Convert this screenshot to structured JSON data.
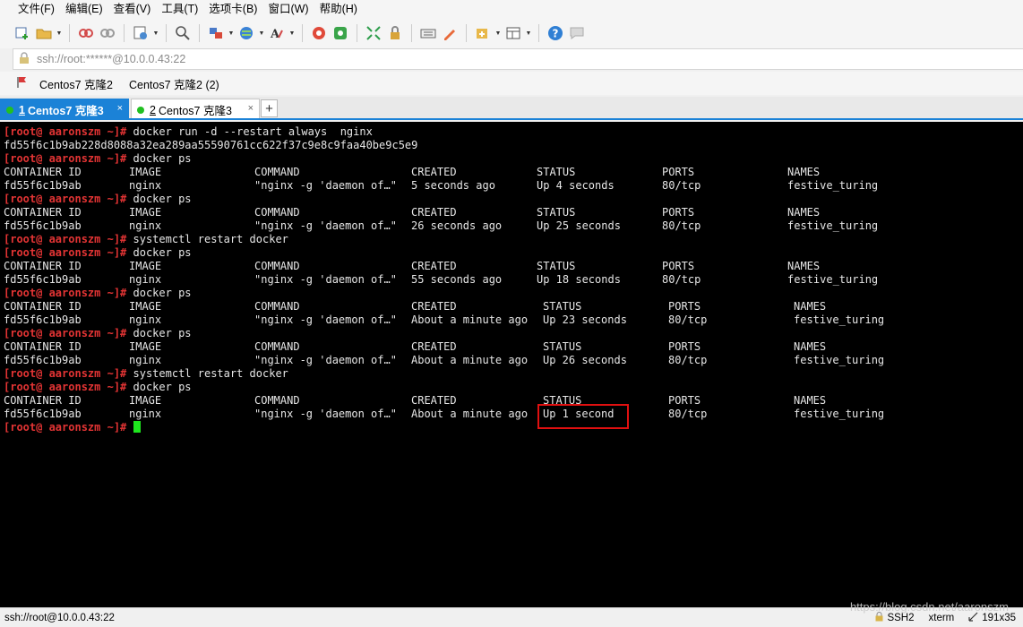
{
  "menu": [
    "文件(F)",
    "编辑(E)",
    "查看(V)",
    "工具(T)",
    "选项卡(B)",
    "窗口(W)",
    "帮助(H)"
  ],
  "address": {
    "text": "ssh://root:******@10.0.0.43:22"
  },
  "bookmarks": [
    "Centos7 克隆2",
    "Centos7 克隆2 (2)"
  ],
  "tabs": [
    {
      "num": "1",
      "label": "Centos7 克隆3",
      "close": "×",
      "active": true
    },
    {
      "num": "2",
      "label": "Centos7 克隆3",
      "close": "×",
      "active": false
    }
  ],
  "tab_add": "+",
  "terminal": {
    "prompt": "[root@ aaronszm ~]#",
    "cursor_line": 22,
    "lines": [
      {
        "type": "cmd",
        "text": " docker run -d --restart always  nginx"
      },
      {
        "type": "out",
        "text": "fd55f6c1b9ab228d8088a32ea289aa55590761cc622f37c9e8c9faa40be9c5e9"
      },
      {
        "type": "cmd",
        "text": " docker ps"
      },
      {
        "type": "row",
        "cells": [
          "CONTAINER ID",
          "IMAGE",
          "COMMAND",
          "CREATED",
          "STATUS",
          "PORTS",
          "NAMES"
        ],
        "shift": false
      },
      {
        "type": "row",
        "cells": [
          "fd55f6c1b9ab",
          "nginx",
          "\"nginx -g 'daemon of…\"",
          "5 seconds ago",
          "Up 4 seconds",
          "80/tcp",
          "festive_turing"
        ],
        "shift": false
      },
      {
        "type": "cmd",
        "text": " docker ps"
      },
      {
        "type": "row",
        "cells": [
          "CONTAINER ID",
          "IMAGE",
          "COMMAND",
          "CREATED",
          "STATUS",
          "PORTS",
          "NAMES"
        ],
        "shift": false
      },
      {
        "type": "row",
        "cells": [
          "fd55f6c1b9ab",
          "nginx",
          "\"nginx -g 'daemon of…\"",
          "26 seconds ago",
          "Up 25 seconds",
          "80/tcp",
          "festive_turing"
        ],
        "shift": false
      },
      {
        "type": "cmd",
        "text": " systemctl restart docker"
      },
      {
        "type": "cmd",
        "text": " docker ps"
      },
      {
        "type": "row",
        "cells": [
          "CONTAINER ID",
          "IMAGE",
          "COMMAND",
          "CREATED",
          "STATUS",
          "PORTS",
          "NAMES"
        ],
        "shift": false
      },
      {
        "type": "row",
        "cells": [
          "fd55f6c1b9ab",
          "nginx",
          "\"nginx -g 'daemon of…\"",
          "55 seconds ago",
          "Up 18 seconds",
          "80/tcp",
          "festive_turing"
        ],
        "shift": false
      },
      {
        "type": "cmd",
        "text": " docker ps"
      },
      {
        "type": "row",
        "cells": [
          "CONTAINER ID",
          "IMAGE",
          "COMMAND",
          "CREATED",
          "STATUS",
          "PORTS",
          "NAMES"
        ],
        "shift": true
      },
      {
        "type": "row",
        "cells": [
          "fd55f6c1b9ab",
          "nginx",
          "\"nginx -g 'daemon of…\"",
          "About a minute ago",
          "Up 23 seconds",
          "80/tcp",
          "festive_turing"
        ],
        "shift": true
      },
      {
        "type": "cmd",
        "text": " docker ps"
      },
      {
        "type": "row",
        "cells": [
          "CONTAINER ID",
          "IMAGE",
          "COMMAND",
          "CREATED",
          "STATUS",
          "PORTS",
          "NAMES"
        ],
        "shift": true
      },
      {
        "type": "row",
        "cells": [
          "fd55f6c1b9ab",
          "nginx",
          "\"nginx -g 'daemon of…\"",
          "About a minute ago",
          "Up 26 seconds",
          "80/tcp",
          "festive_turing"
        ],
        "shift": true
      },
      {
        "type": "cmd",
        "text": " systemctl restart docker"
      },
      {
        "type": "cmd",
        "text": " docker ps"
      },
      {
        "type": "row",
        "cells": [
          "CONTAINER ID",
          "IMAGE",
          "COMMAND",
          "CREATED",
          "STATUS",
          "PORTS",
          "NAMES"
        ],
        "shift": true
      },
      {
        "type": "row",
        "cells": [
          "fd55f6c1b9ab",
          "nginx",
          "\"nginx -g 'daemon of…\"",
          "About a minute ago",
          "Up 1 second",
          "80/tcp",
          "festive_turing"
        ],
        "shift": true
      },
      {
        "type": "cmd",
        "text": " "
      }
    ]
  },
  "status": {
    "connection": "ssh://root@10.0.0.43:22",
    "protocol": "SSH2",
    "terminal_type": "xterm",
    "size": "191x35"
  },
  "watermark": "https://blog.csdn.net/aaronszm",
  "colors": {
    "tab_active": "#1b82d7",
    "prompt": "#e33434",
    "cursor": "#1ee61e",
    "highlight": "#e01010"
  }
}
